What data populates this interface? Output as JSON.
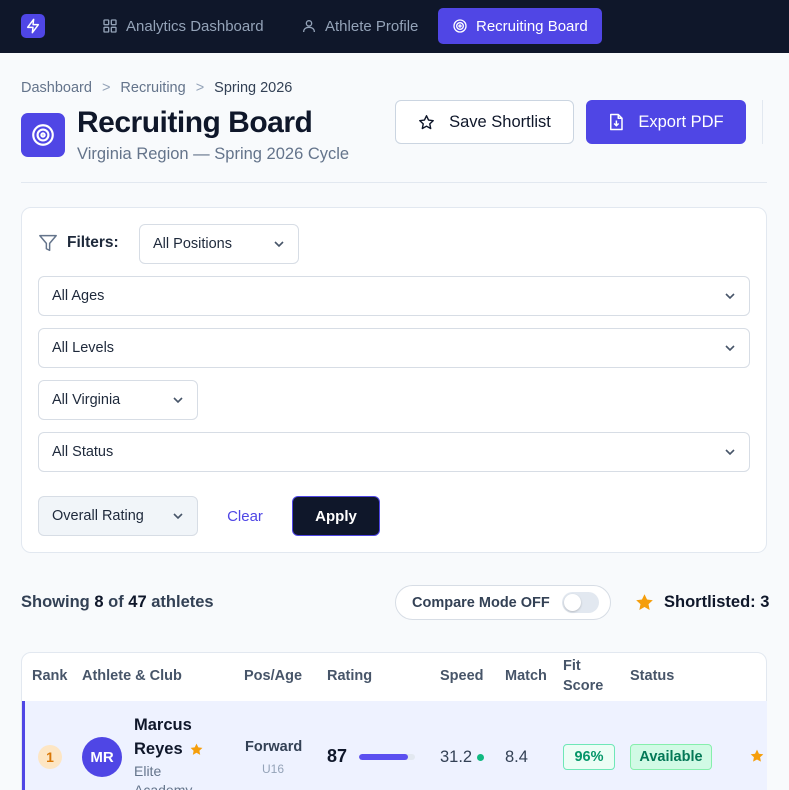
{
  "nav": {
    "tabs": [
      {
        "label": "Analytics Dashboard",
        "icon": "grid-icon"
      },
      {
        "label": "Athlete Profile",
        "icon": "user-icon"
      },
      {
        "label": "Recruiting Board",
        "icon": "target-icon",
        "active": true
      }
    ]
  },
  "breadcrumb": [
    "Dashboard",
    "Recruiting",
    "Spring 2026"
  ],
  "breadcrumb_separator": ">",
  "header": {
    "title": "Recruiting Board",
    "subtitle": "Virginia Region — Spring 2026 Cycle",
    "save_label": "Save Shortlist",
    "export_label": "Export PDF"
  },
  "filters": {
    "label": "Filters:",
    "position": "All Positions",
    "age": "All Ages",
    "level": "All Levels",
    "region": "All Virginia",
    "status": "All Status",
    "sort": "Overall Rating",
    "clear_label": "Clear",
    "apply_label": "Apply"
  },
  "results": {
    "prefix": "Showing",
    "shown": "8",
    "of": "of",
    "total": "47",
    "suffix": "athletes",
    "compare_label": "Compare Mode OFF",
    "compare_on": false,
    "shortlisted_label": "Shortlisted: 3"
  },
  "table": {
    "columns": {
      "rank": "Rank",
      "athlete": "Athlete & Club",
      "pos_age": "Pos/Age",
      "rating": "Rating",
      "speed": "Speed",
      "match": "Match",
      "fit_line1": "Fit",
      "fit_line2": "Score",
      "status": "Status"
    },
    "rows": [
      {
        "rank": "1",
        "initials": "MR",
        "first_name": "Marcus",
        "last_name": "Reyes",
        "club_line1": "Elite",
        "club_line2": "Academy",
        "position": "Forward",
        "age": "U16",
        "rating": "87",
        "rating_fraction": 0.87,
        "speed": "31.2",
        "match": "8.4",
        "fit": "96%",
        "status": "Available",
        "shortlisted": true
      }
    ]
  },
  "colors": {
    "accent": "#4f46e5",
    "nav_bg": "#0f172a",
    "star": "#f59e0b",
    "success": "#10b981"
  }
}
